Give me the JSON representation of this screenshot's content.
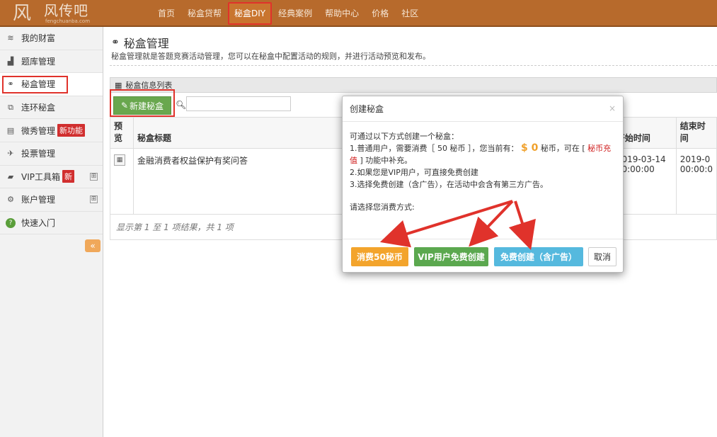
{
  "header": {
    "logo_mark": "风",
    "logo_text": "风传吧",
    "logo_sub": "fengchuanba.com",
    "nav": [
      "首页",
      "秘盒贷帮",
      "秘盒DIY",
      "经典案例",
      "帮助中心",
      "价格",
      "社区"
    ],
    "nav_active_index": 2
  },
  "sidebar": {
    "items": [
      {
        "label": "我的财富",
        "icon": "wealth-icon"
      },
      {
        "label": "题库管理",
        "icon": "bank-icon"
      },
      {
        "label": "秘盒管理",
        "icon": "box-icon"
      },
      {
        "label": "连环秘盒",
        "icon": "chain-icon"
      },
      {
        "label": "微秀管理",
        "icon": "film-icon",
        "badge": "新功能"
      },
      {
        "label": "投票管理",
        "icon": "vote-icon"
      },
      {
        "label": "VIP工具箱",
        "icon": "toolbox-icon",
        "badge": "新",
        "expand": "⊞"
      },
      {
        "label": "账户管理",
        "icon": "gears-icon",
        "expand": "⊞"
      },
      {
        "label": "快速入门",
        "icon": "help-icon"
      }
    ],
    "active_index": 2,
    "toggle": "«"
  },
  "main": {
    "title": "秘盒管理",
    "description": "秘盒管理就是答题竞赛活动管理，您可以在秘盒中配置活动的规则，并进行活动预览和发布。",
    "panel_title": "秘盒信息列表",
    "new_button": "新建秘盒",
    "table": {
      "headers": [
        "预览",
        "秘盒标题",
        "开始时间",
        "结束时间"
      ],
      "rows": [
        {
          "title": "金融消费者权益保护有奖问答",
          "start": "2019-03-14 00:00:00",
          "end": "2019-0 00:00:0"
        }
      ]
    },
    "pager": "显示第 1 至 1 项结果，共 1 项"
  },
  "modal": {
    "title": "创建秘盒",
    "close": "×",
    "intro": "可通过以下方式创建一个秘盒：",
    "line1_a": "1.普通用户，需要消费［ 50 秘币 ］，您当前有：",
    "line1_money": "$ 0",
    "line1_b": "秘币，可在 [",
    "line1_link": "秘币充值",
    "line1_c": "] 功能中补充。",
    "line2": "2.如果您是VIP用户，可直接免费创建",
    "line3": "3.选择免费创建（含广告），在活动中会含有第三方广告。",
    "prompt": "请选择您消费方式:",
    "buttons": {
      "pay": "消费50秘币",
      "vip": "VIP用户免费创建",
      "free": "免费创建（含广告）",
      "cancel": "取消"
    }
  }
}
